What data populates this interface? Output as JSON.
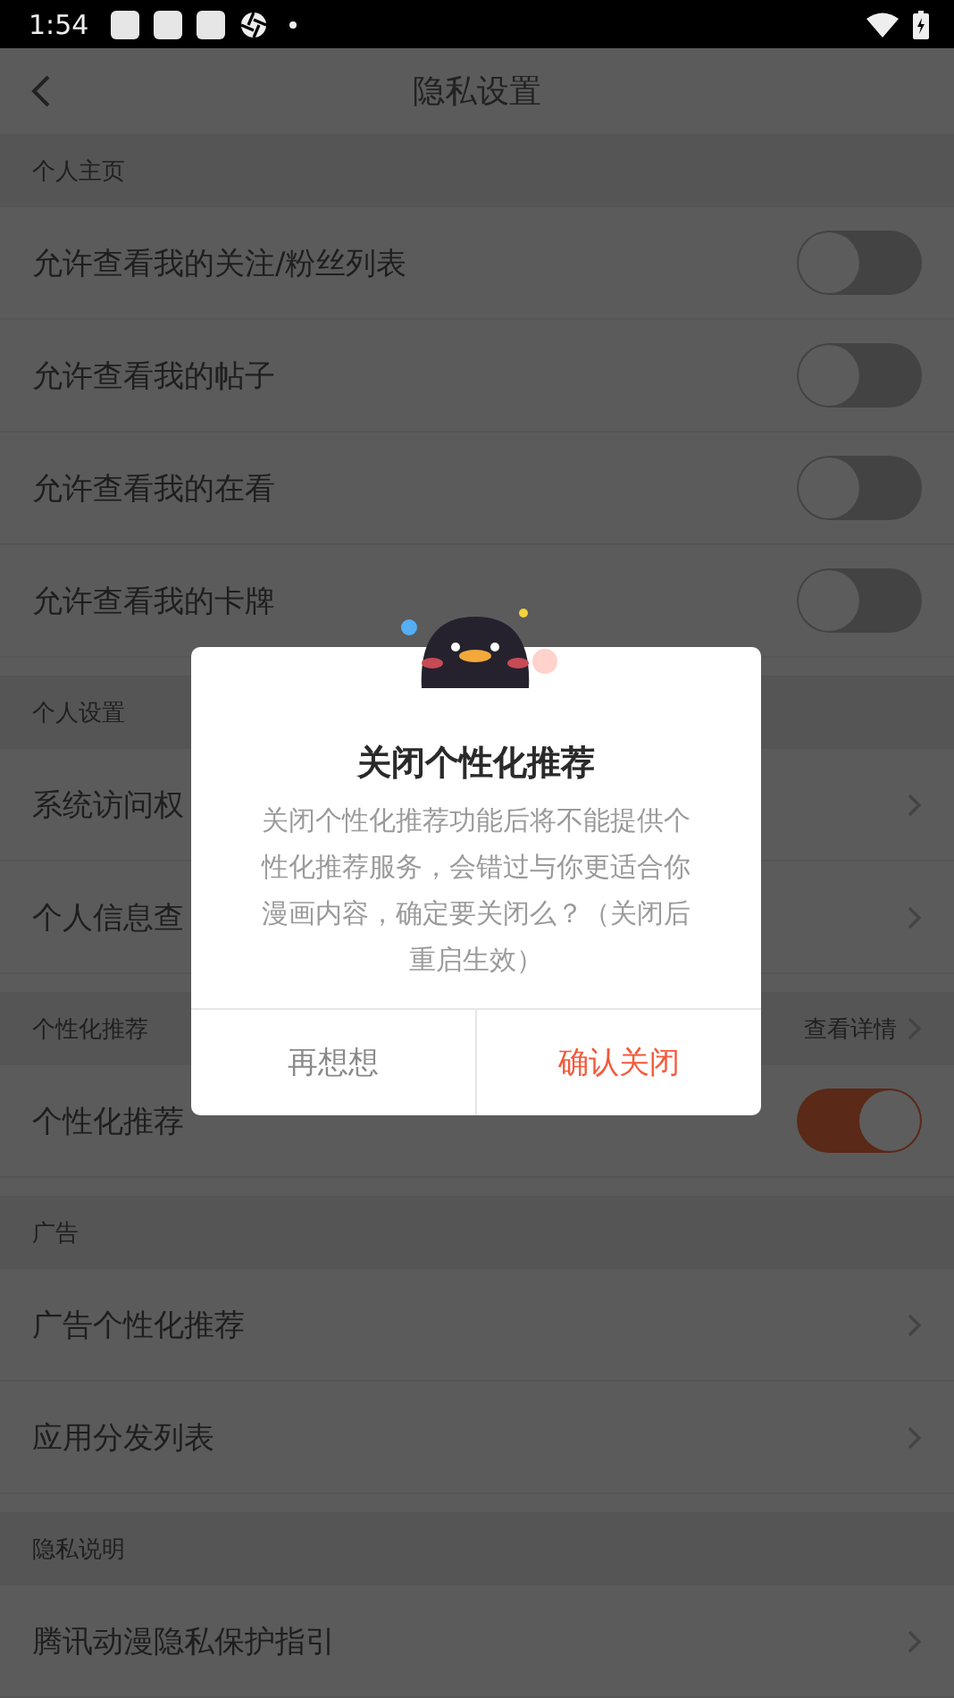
{
  "status_bar": {
    "time": "1:54"
  },
  "header": {
    "title": "隐私设置"
  },
  "sections": [
    {
      "title": "个人主页",
      "items": [
        {
          "kind": "toggle",
          "label": "允许查看我的关注/粉丝列表",
          "on": false
        },
        {
          "kind": "toggle",
          "label": "允许查看我的帖子",
          "on": false
        },
        {
          "kind": "toggle",
          "label": "允许查看我的在看",
          "on": false
        },
        {
          "kind": "toggle",
          "label": "允许查看我的卡牌",
          "on": false
        }
      ]
    },
    {
      "title": "个人设置",
      "items": [
        {
          "kind": "link",
          "label": "系统访问权"
        },
        {
          "kind": "link",
          "label": "个人信息查"
        }
      ]
    },
    {
      "title": "个性化推荐",
      "link": "查看详情",
      "items": [
        {
          "kind": "toggle",
          "label": "个性化推荐",
          "on": true
        }
      ]
    },
    {
      "title": "广告",
      "items": [
        {
          "kind": "link",
          "label": "广告个性化推荐"
        },
        {
          "kind": "link",
          "label": "应用分发列表"
        }
      ]
    },
    {
      "title": "隐私说明",
      "items": [
        {
          "kind": "link",
          "label": "腾讯动漫隐私保护指引"
        }
      ]
    }
  ],
  "dialog": {
    "title": "关闭个性化推荐",
    "message": "关闭个性化推荐功能后将不能提供个性化推荐服务，会错过与你更适合你漫画内容，确定要关闭么？（关闭后重启生效）",
    "buttons": [
      {
        "label": "再想想",
        "kind": "secondary"
      },
      {
        "label": "确认关闭",
        "kind": "primary"
      }
    ]
  }
}
